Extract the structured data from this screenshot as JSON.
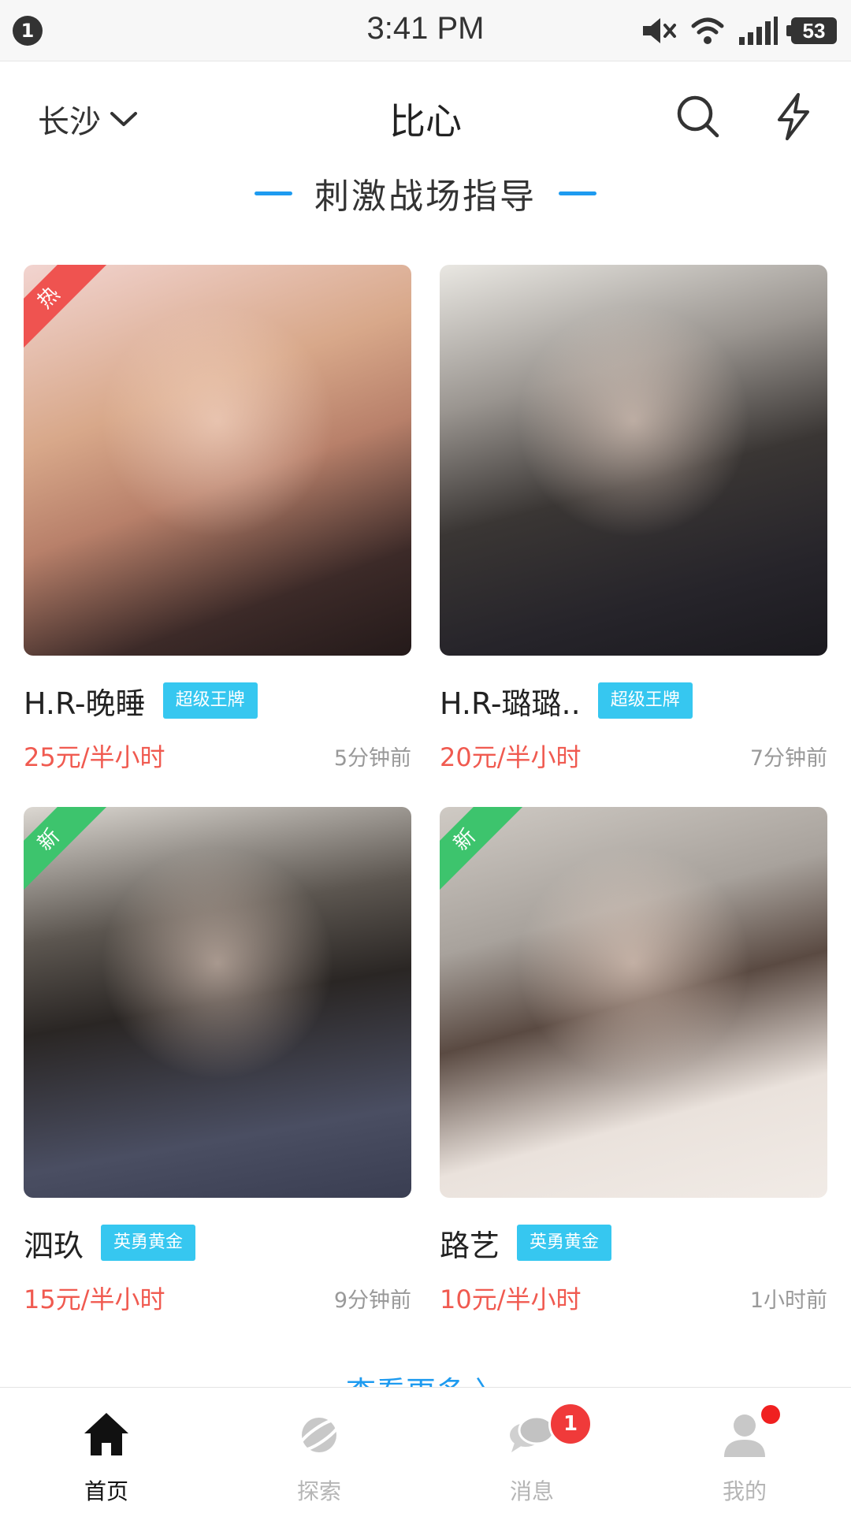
{
  "status_bar": {
    "notification_count": "1",
    "time": "3:41 PM",
    "battery": "53",
    "icons": [
      "mute-icon",
      "wifi-icon",
      "signal-icon",
      "battery-icon"
    ]
  },
  "header": {
    "city": "长沙",
    "title": "比心",
    "icons": [
      "chevron-down-icon",
      "search-icon",
      "lightning-icon"
    ]
  },
  "section": {
    "title": "刺激战场指导"
  },
  "cards": [
    {
      "name": "H.R-晚睡",
      "badge": "超级王牌",
      "price": "25元/半小时",
      "time": "5分钟前",
      "ribbon": "热"
    },
    {
      "name": "H.R-璐璐..",
      "badge": "超级王牌",
      "price": "20元/半小时",
      "time": "7分钟前",
      "ribbon": ""
    },
    {
      "name": "泗玖",
      "badge": "英勇黄金",
      "price": "15元/半小时",
      "time": "9分钟前",
      "ribbon": "新"
    },
    {
      "name": "路艺",
      "badge": "英勇黄金",
      "price": "10元/半小时",
      "time": "1小时前",
      "ribbon": "新"
    }
  ],
  "see_more": "查看更多 〉",
  "nav": {
    "items": [
      {
        "label": "首页",
        "icon": "home-icon"
      },
      {
        "label": "探索",
        "icon": "planet-icon"
      },
      {
        "label": "消息",
        "icon": "chat-icon"
      },
      {
        "label": "我的",
        "icon": "profile-icon"
      }
    ],
    "message_count": "1"
  },
  "colors": {
    "accent_blue": "#1e9bf0",
    "price_red": "#f05a50",
    "badge_cyan": "#36c7f0",
    "hot_ribbon": "#ef5350",
    "new_ribbon": "#3dc46d"
  }
}
